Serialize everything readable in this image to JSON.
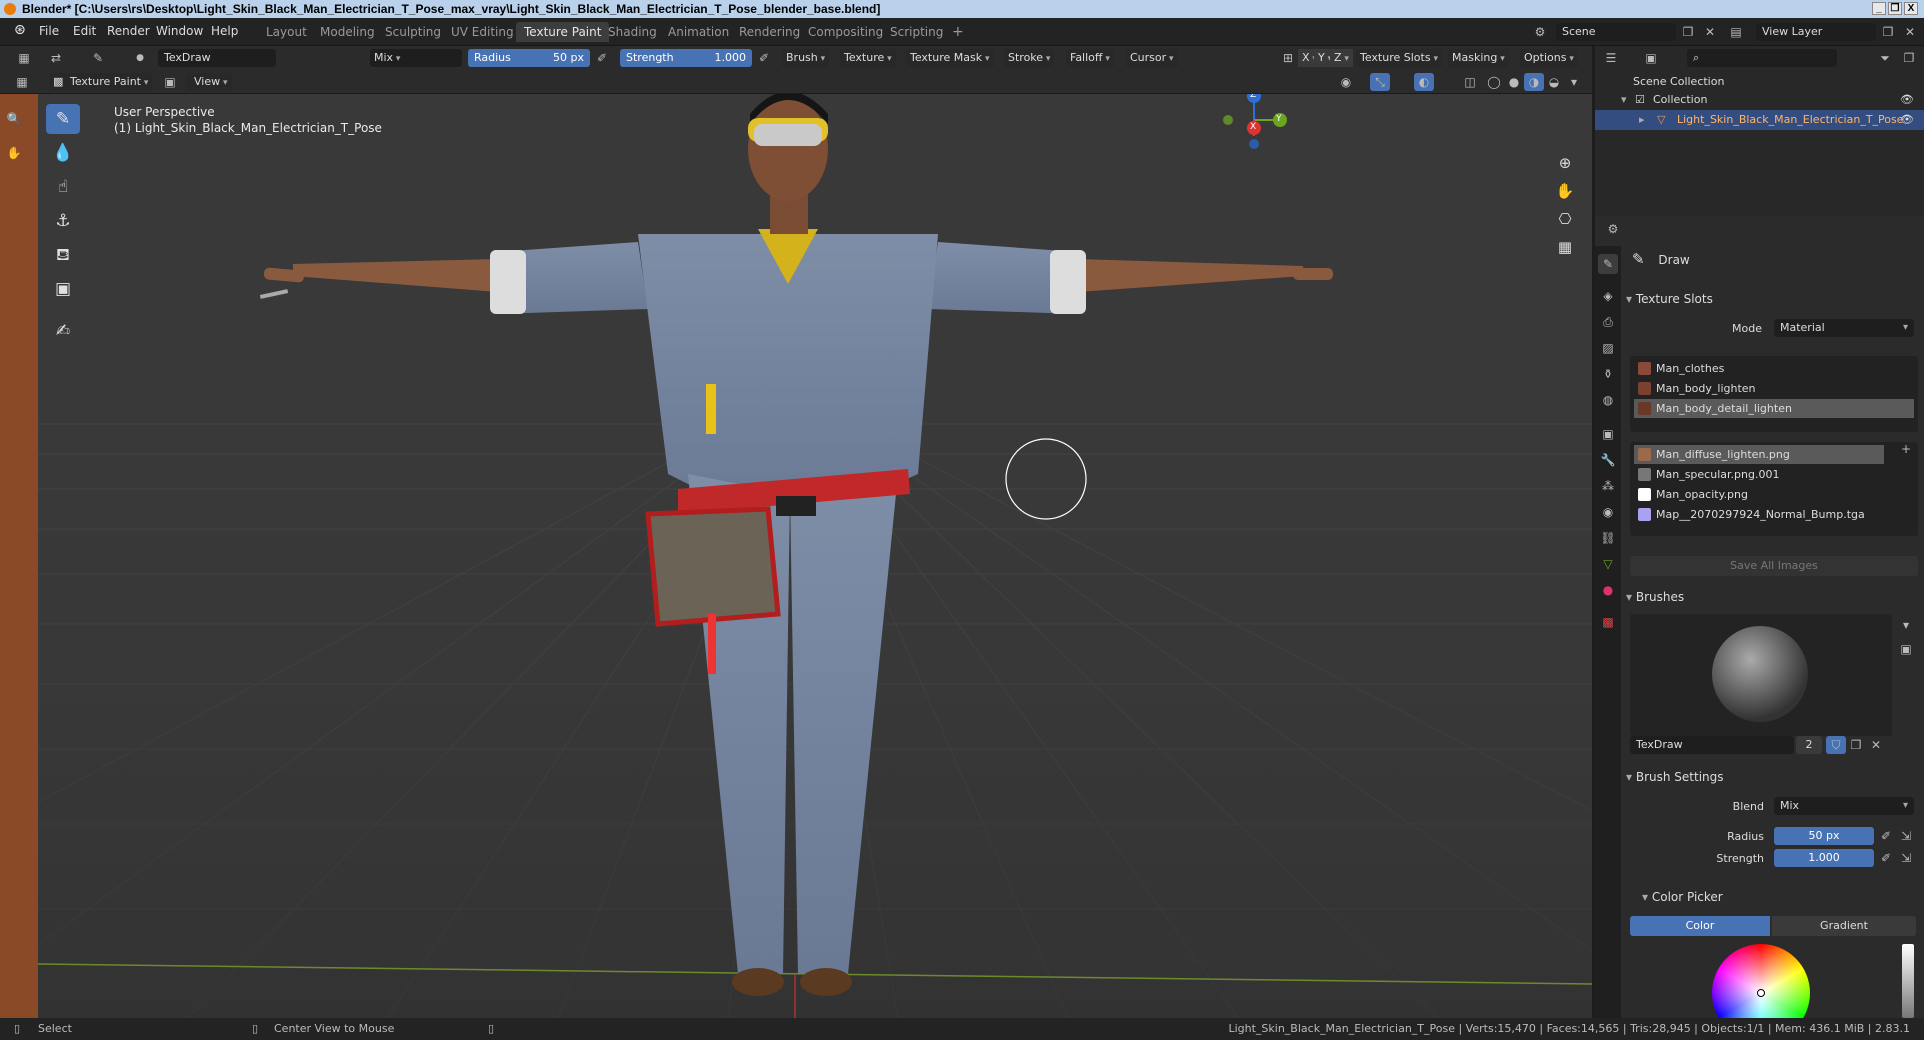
{
  "window": {
    "title": "Blender* [C:\\Users\\rs\\Desktop\\Light_Skin_Black_Man_Electrician_T_Pose_max_vray\\Light_Skin_Black_Man_Electrician_T_Pose_blender_base.blend]",
    "min": "_",
    "max": "❐",
    "close": "X"
  },
  "menu": [
    "File",
    "Edit",
    "Render",
    "Window",
    "Help"
  ],
  "workspaces": [
    "Layout",
    "Modeling",
    "Sculpting",
    "UV Editing",
    "Texture Paint",
    "Shading",
    "Animation",
    "Rendering",
    "Compositing",
    "Scripting"
  ],
  "workspace_add": "+",
  "active_workspace": "Texture Paint",
  "scene": {
    "label": "Scene",
    "view_layer": "View Layer"
  },
  "toolheader": {
    "brush_name": "TexDraw",
    "blend": "Mix",
    "radius_label": "Radius",
    "radius_value": "50 px",
    "strength_label": "Strength",
    "strength_value": "1.000",
    "brush": "Brush",
    "texture": "Texture",
    "texture_mask": "Texture Mask",
    "stroke": "Stroke",
    "falloff": "Falloff",
    "cursor": "Cursor",
    "axis_x": "X",
    "axis_y": "Y",
    "axis_z": "Z",
    "texture_slots": "Texture Slots",
    "masking": "Masking",
    "options": "Options"
  },
  "subheader": {
    "mode": "Texture Paint",
    "view": "View"
  },
  "viewport": {
    "perspective": "User Perspective",
    "object": "(1) Light_Skin_Black_Man_Electrician_T_Pose",
    "gizmo": {
      "x": "X",
      "y": "Y",
      "z": "Z"
    }
  },
  "outliner": {
    "root": "Scene Collection",
    "collection": "Collection",
    "object": "Light_Skin_Black_Man_Electrician_T_Pose"
  },
  "properties": {
    "tool_name": "Draw",
    "texture_slots": {
      "title": "Texture Slots",
      "mode_label": "Mode",
      "mode_value": "Material",
      "materials": [
        {
          "name": "Man_clothes",
          "color": "#8a4a3a"
        },
        {
          "name": "Man_body_lighten",
          "color": "#7a4030"
        },
        {
          "name": "Man_body_detail_lighten",
          "color": "#6a3828"
        }
      ],
      "images": [
        {
          "name": "Man_diffuse_lighten.png",
          "color": "#9b6a4a"
        },
        {
          "name": "Man_specular.png.001",
          "color": "#777777"
        },
        {
          "name": "Man_opacity.png",
          "color": "#ffffff"
        },
        {
          "name": "Map__2070297924_Normal_Bump.tga",
          "color": "#a9a3ef"
        }
      ],
      "save_all": "Save All Images"
    },
    "brushes": {
      "title": "Brushes",
      "brush_name": "TexDraw",
      "users": "2"
    },
    "brush_settings": {
      "title": "Brush Settings",
      "blend_label": "Blend",
      "blend_value": "Mix",
      "radius_label": "Radius",
      "radius_value": "50 px",
      "strength_label": "Strength",
      "strength_value": "1.000"
    },
    "color_picker": {
      "title": "Color Picker",
      "tab_color": "Color",
      "tab_gradient": "Gradient"
    }
  },
  "statusbar": {
    "select": "Select",
    "center_view": "Center View to Mouse",
    "stats": "Light_Skin_Black_Man_Electrician_T_Pose | Verts:15,470 | Faces:14,565 | Tris:28,945 | Objects:1/1 | Mem: 436.1 MiB | 2.83.1"
  },
  "colors": {
    "accent": "#4772b3",
    "viewport_bg": "#393939",
    "toolbar_left": "#8b4a27",
    "title_bar": "#b9d1ea"
  }
}
